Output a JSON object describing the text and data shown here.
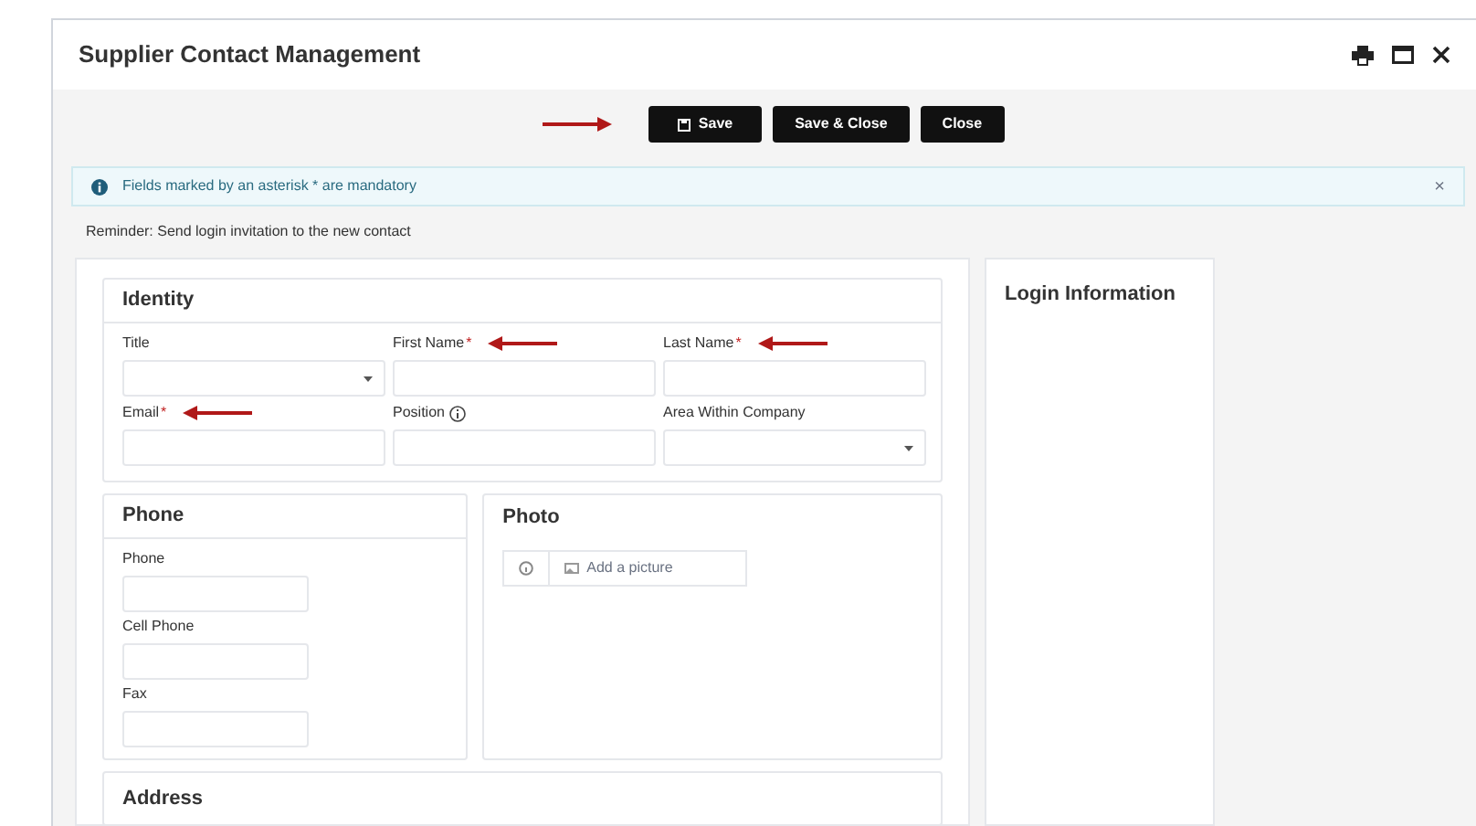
{
  "window": {
    "title": "Supplier Contact Management"
  },
  "toolbar": {
    "annotated": true,
    "buttons": [
      {
        "label": "Save",
        "kind": "save"
      },
      {
        "label": "Save & Close",
        "kind": "plain"
      },
      {
        "label": "Close",
        "kind": "plain"
      }
    ]
  },
  "notice": {
    "text": "Fields marked by an asterisk * are mandatory",
    "close": "×"
  },
  "reminder": "Reminder: Send login invitation to the new contact",
  "identity": {
    "title": "Identity",
    "fields": [
      {
        "label": "Title",
        "kind": "select",
        "annotated": false
      },
      {
        "label": "First Name",
        "mark": "*",
        "kind": "text",
        "annotated": true
      },
      {
        "label": "Last Name",
        "mark": "*",
        "kind": "text",
        "annotated": true
      },
      {
        "label": "Email",
        "mark": "*",
        "kind": "text",
        "annotated": true
      },
      {
        "label": "Position",
        "kind": "text",
        "info": true,
        "annotated": false
      },
      {
        "label": "Area Within Company",
        "kind": "select",
        "annotated": false
      }
    ]
  },
  "phone": {
    "title": "Phone",
    "fields": [
      {
        "label": "Phone"
      },
      {
        "label": "Cell Phone"
      },
      {
        "label": "Fax"
      }
    ]
  },
  "photo": {
    "title": "Photo",
    "add_button": "Add a picture"
  },
  "address": {
    "title": "Address"
  },
  "login": {
    "title": "Login Information"
  }
}
